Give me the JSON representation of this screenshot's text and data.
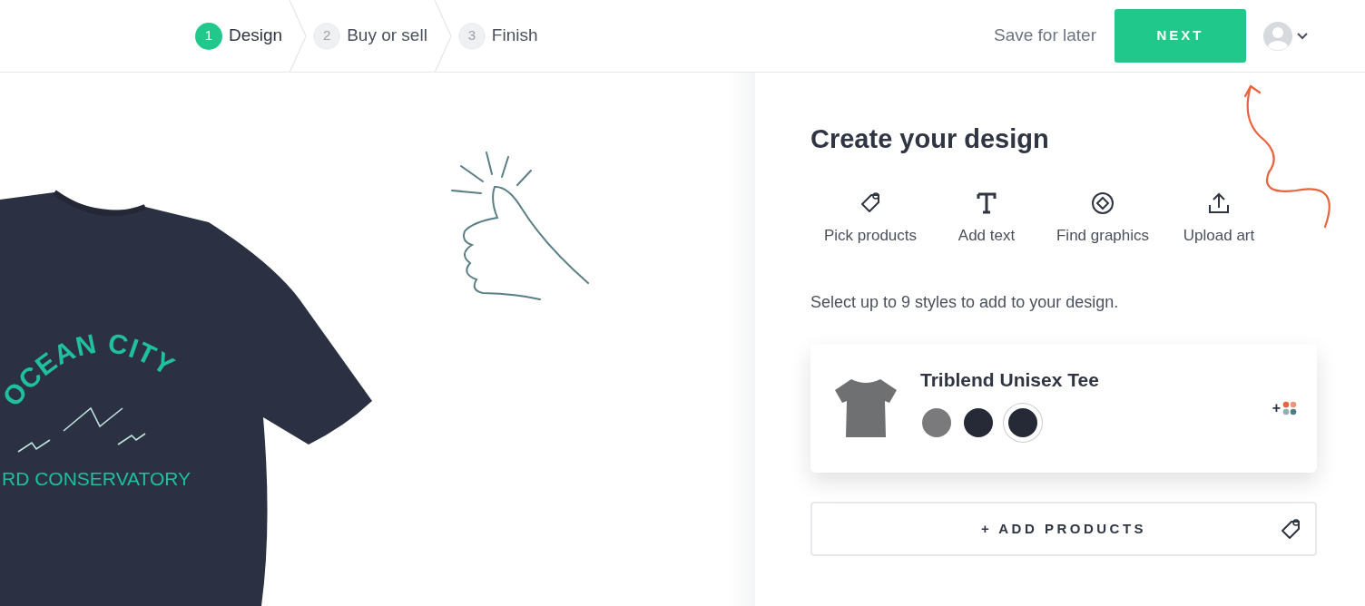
{
  "steps": [
    {
      "number": "1",
      "label": "Design",
      "selected": true
    },
    {
      "number": "2",
      "label": "Buy or sell",
      "selected": false
    },
    {
      "number": "3",
      "label": "Finish",
      "selected": false
    }
  ],
  "header": {
    "save_link": "Save for later",
    "next_button": "NEXT"
  },
  "canvas": {
    "shirt_print": {
      "arc_text": "OCEAN CITY",
      "bottom_text": "RD CONSERVATORY"
    }
  },
  "panel": {
    "title": "Create your design",
    "tools": [
      {
        "kind": "tag",
        "label": "Pick products"
      },
      {
        "kind": "text",
        "label": "Add text"
      },
      {
        "kind": "graphics",
        "label": "Find graphics"
      },
      {
        "kind": "upload",
        "label": "Upload art"
      }
    ],
    "hint": "Select up to 9 styles to add to your design.",
    "product": {
      "name": "Triblend Unisex Tee",
      "swatches": [
        {
          "color": "#7a7a7c",
          "selected": false
        },
        {
          "color": "#262a36",
          "selected": false
        },
        {
          "color": "#262a36",
          "selected": true
        }
      ],
      "more_colors": "+"
    },
    "add_button": "+ ADD PRODUCTS"
  }
}
